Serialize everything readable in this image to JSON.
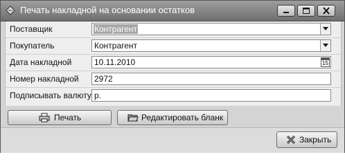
{
  "window": {
    "title": "Печать накладной на основании остатков",
    "icons": {
      "app": "document-icon",
      "minimize": "minimize-icon",
      "maximize": "maximize-icon",
      "close": "close-icon"
    }
  },
  "form": {
    "supplier": {
      "label": "Поставщик",
      "value": "Контрагент"
    },
    "buyer": {
      "label": "Покупатель",
      "value": "Контрагент"
    },
    "date": {
      "label": "Дата накладной",
      "value": "10.11.2010",
      "calendar_day": "15"
    },
    "number": {
      "label": "Номер накладной",
      "value": "2972"
    },
    "currency": {
      "label": "Подписывать валюту",
      "value": "р."
    }
  },
  "buttons": {
    "print": "Печать",
    "edit_form": "Редактировать бланк",
    "close": "Закрыть"
  }
}
